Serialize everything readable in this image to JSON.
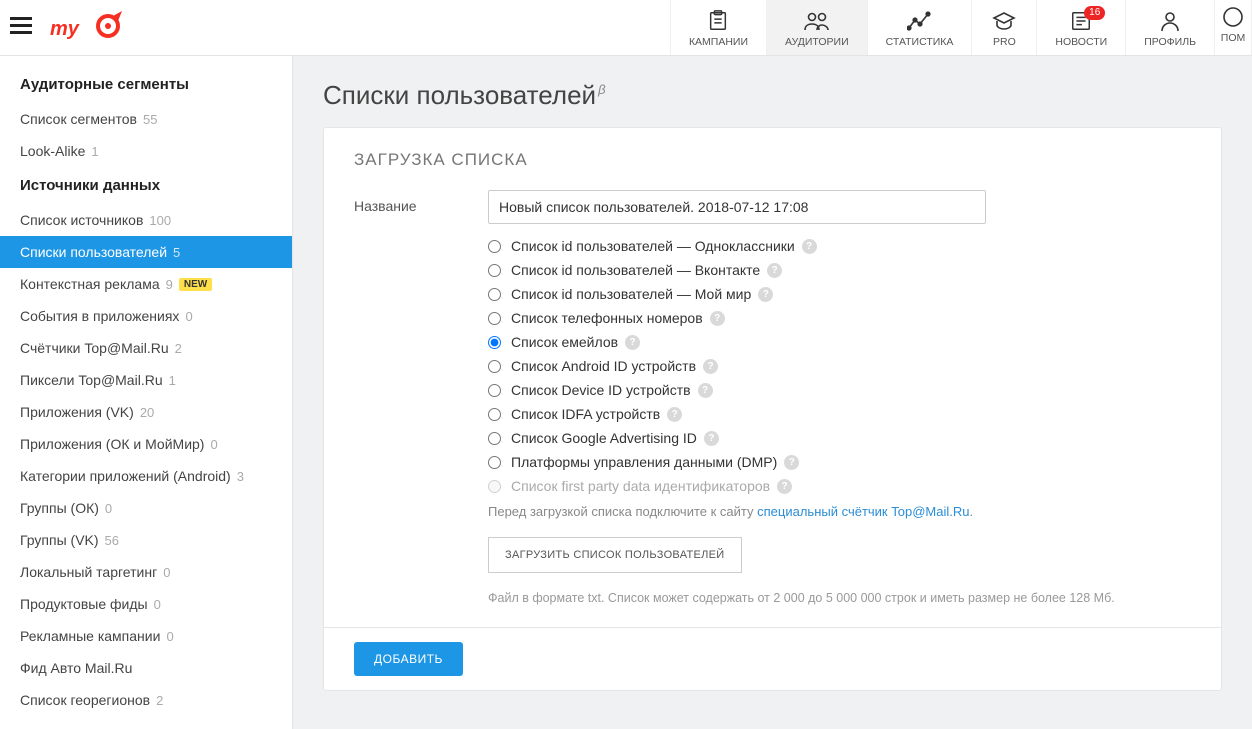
{
  "header": {
    "nav": [
      {
        "icon": "campaign-icon",
        "label": "КАМПАНИИ",
        "badge": null
      },
      {
        "icon": "audience-icon",
        "label": "АУДИТОРИИ",
        "badge": null,
        "active": true
      },
      {
        "icon": "stats-icon",
        "label": "СТАТИСТИКА",
        "badge": null
      },
      {
        "icon": "pro-icon",
        "label": "PRO",
        "badge": null
      },
      {
        "icon": "news-icon",
        "label": "НОВОСТИ",
        "badge": "16"
      },
      {
        "icon": "profile-icon",
        "label": "ПРОФИЛЬ",
        "badge": null
      },
      {
        "icon": "help-icon",
        "label": "ПОМ",
        "badge": null,
        "partial": true
      }
    ]
  },
  "sidebar": {
    "sections": [
      {
        "heading": "Аудиторные сегменты",
        "items": [
          {
            "label": "Список сегментов",
            "count": "55"
          },
          {
            "label": "Look-Alike",
            "count": "1"
          }
        ]
      },
      {
        "heading": "Источники данных",
        "items": [
          {
            "label": "Список источников",
            "count": "100"
          },
          {
            "label": "Списки пользователей",
            "count": "5",
            "active": true
          },
          {
            "label": "Контекстная реклама",
            "count": "9",
            "tag": "NEW"
          },
          {
            "label": "События в приложениях",
            "count": "0"
          },
          {
            "label": "Счётчики Top@Mail.Ru",
            "count": "2"
          },
          {
            "label": "Пиксели Top@Mail.Ru",
            "count": "1"
          },
          {
            "label": "Приложения (VK)",
            "count": "20"
          },
          {
            "label": "Приложения (ОК и МойМир)",
            "count": "0"
          },
          {
            "label": "Категории приложений (Android)",
            "count": "3"
          },
          {
            "label": "Группы (ОК)",
            "count": "0"
          },
          {
            "label": "Группы (VK)",
            "count": "56"
          },
          {
            "label": "Локальный таргетинг",
            "count": "0"
          },
          {
            "label": "Продуктовые фиды",
            "count": "0"
          },
          {
            "label": "Рекламные кампании",
            "count": "0"
          },
          {
            "label": "Фид Авто Mail.Ru",
            "count": ""
          },
          {
            "label": "Список георегионов",
            "count": "2"
          }
        ]
      }
    ]
  },
  "main": {
    "page_title": "Списки пользователей",
    "page_title_sup": "β",
    "panel_title": "ЗАГРУЗКА СПИСКА",
    "name_label": "Название",
    "name_value": "Новый список пользователей. 2018-07-12 17:08",
    "radios": [
      {
        "label": "Список id пользователей — Одноклассники",
        "checked": false,
        "disabled": false
      },
      {
        "label": "Список id пользователей — Вконтакте",
        "checked": false,
        "disabled": false
      },
      {
        "label": "Список id пользователей — Мой мир",
        "checked": false,
        "disabled": false
      },
      {
        "label": "Список телефонных номеров",
        "checked": false,
        "disabled": false
      },
      {
        "label": "Список емейлов",
        "checked": true,
        "disabled": false
      },
      {
        "label": "Список Android ID устройств",
        "checked": false,
        "disabled": false
      },
      {
        "label": "Список Device ID устройств",
        "checked": false,
        "disabled": false
      },
      {
        "label": "Список IDFA устройств",
        "checked": false,
        "disabled": false
      },
      {
        "label": "Список Google Advertising ID",
        "checked": false,
        "disabled": false
      },
      {
        "label": "Платформы управления данными (DMP)",
        "checked": false,
        "disabled": false
      },
      {
        "label": "Список first party data идентификаторов",
        "checked": false,
        "disabled": true
      }
    ],
    "hint_prefix": "Перед загрузкой списка подключите к сайту ",
    "hint_link": "специальный счётчик Top@Mail.Ru",
    "hint_suffix": ".",
    "upload_button": "ЗАГРУЗИТЬ СПИСОК ПОЛЬЗОВАТЕЛЕЙ",
    "file_hint": "Файл в формате txt. Список может содержать от 2 000 до 5 000 000 строк и иметь размер не более 128 Мб.",
    "add_button": "ДОБАВИТЬ"
  },
  "icons": {
    "help_q": "?"
  }
}
